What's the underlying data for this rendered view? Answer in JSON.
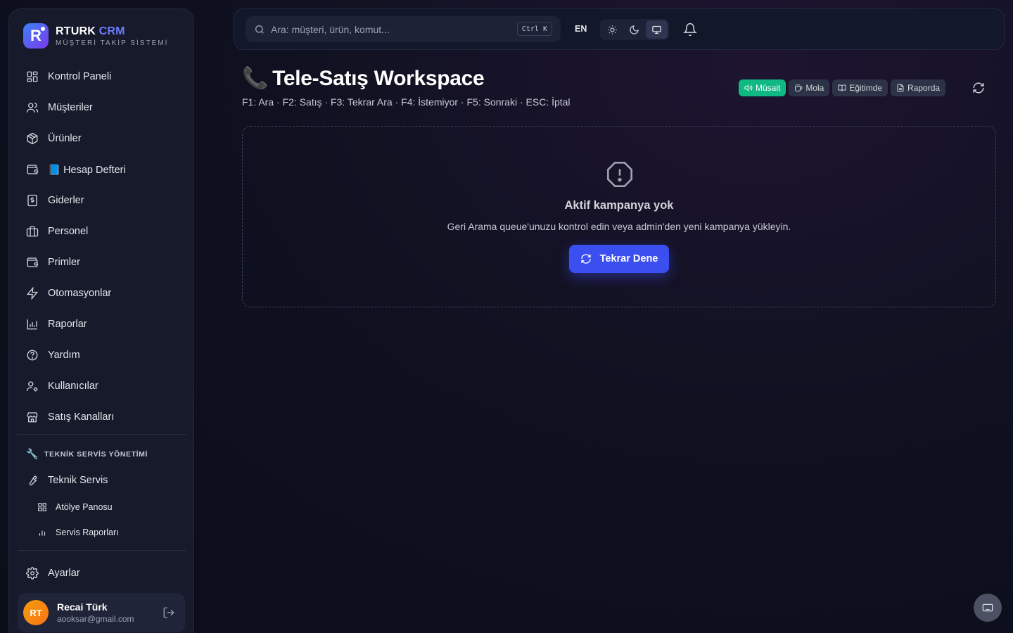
{
  "brand": {
    "name": "RTURK",
    "name_accent": "CRM",
    "subtitle": "MÜŞTERİ TAKİP SİSTEMİ",
    "logo_letter": "R"
  },
  "sidebar": {
    "items": [
      {
        "label": "Kontrol Paneli",
        "icon": "dashboard-icon"
      },
      {
        "label": "Müşteriler",
        "icon": "users-icon"
      },
      {
        "label": "Ürünler",
        "icon": "package-icon"
      },
      {
        "label": "📘 Hesap Defteri",
        "icon": "wallet-icon"
      },
      {
        "label": "Giderler",
        "icon": "receipt-icon"
      },
      {
        "label": "Personel",
        "icon": "briefcase-icon"
      },
      {
        "label": "Primler",
        "icon": "wallet-icon"
      },
      {
        "label": "Otomasyonlar",
        "icon": "lightning-icon"
      },
      {
        "label": "Raporlar",
        "icon": "chart-icon"
      },
      {
        "label": "Yardım",
        "icon": "help-icon"
      },
      {
        "label": "Kullanıcılar",
        "icon": "user-cog-icon"
      },
      {
        "label": "Satış Kanalları",
        "icon": "store-icon"
      }
    ],
    "section_title": "TEKNİK SERVİS YÖNETİMİ",
    "section_items": [
      {
        "label": "Teknik Servis",
        "icon": "wrench-icon"
      }
    ],
    "sub_items": [
      {
        "label": "Atölye Panosu",
        "icon": "grid-icon"
      },
      {
        "label": "Servis Raporları",
        "icon": "bar-chart-icon"
      }
    ],
    "settings_label": "Ayarlar"
  },
  "user": {
    "initials": "RT",
    "name": "Recai Türk",
    "email": "aooksar@gmail.com"
  },
  "topbar": {
    "search_placeholder": "Ara: müşteri, ürün, komut...",
    "shortcut": "Ctrl K",
    "language": "EN"
  },
  "main": {
    "title_emoji": "📞",
    "title": "Tele-Satış Workspace",
    "shortcuts": "F1: Ara · F2: Satış · F3: Tekrar Ara · F4: İstemiyor · F5: Sonraki · ESC: İptal",
    "statuses": [
      {
        "label": "Müsait",
        "icon": "speaker-icon",
        "active": true
      },
      {
        "label": "Mola",
        "icon": "coffee-icon",
        "active": false
      },
      {
        "label": "Eğitimde",
        "icon": "book-icon",
        "active": false
      },
      {
        "label": "Raporda",
        "icon": "file-icon",
        "active": false
      }
    ],
    "empty": {
      "title": "Aktif kampanya yok",
      "description": "Geri Arama queue'unuzu kontrol edin veya admin'den yeni kampanya yükleyin.",
      "button": "Tekrar Dene"
    }
  },
  "colors": {
    "accent": "#3b4ef0",
    "success": "#10b981",
    "sidebar_bg": "#161a2b"
  }
}
